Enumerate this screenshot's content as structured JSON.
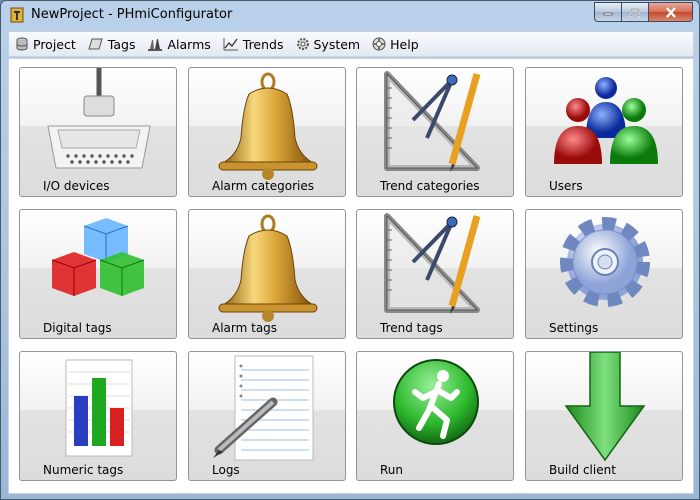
{
  "window": {
    "title": "NewProject - PHmiConfigurator"
  },
  "menu": [
    {
      "label": "Project",
      "icon": "database-icon"
    },
    {
      "label": "Tags",
      "icon": "tag-icon"
    },
    {
      "label": "Alarms",
      "icon": "alarms-icon"
    },
    {
      "label": "Trends",
      "icon": "trend-icon"
    },
    {
      "label": "System",
      "icon": "gear-icon"
    },
    {
      "label": "Help",
      "icon": "lifebuoy-icon"
    }
  ],
  "tiles": [
    {
      "label": "I/O devices",
      "icon": "connector-icon"
    },
    {
      "label": "Alarm categories",
      "icon": "bell-icon"
    },
    {
      "label": "Trend categories",
      "icon": "drafting-tools-icon"
    },
    {
      "label": "Users",
      "icon": "users-icon"
    },
    {
      "label": "Digital tags",
      "icon": "cubes-icon"
    },
    {
      "label": "Alarm tags",
      "icon": "bell-icon"
    },
    {
      "label": "Trend tags",
      "icon": "drafting-tools-icon"
    },
    {
      "label": "Settings",
      "icon": "settings-gear-icon"
    },
    {
      "label": "Numeric tags",
      "icon": "bar-chart-icon"
    },
    {
      "label": "Logs",
      "icon": "notepad-pen-icon"
    },
    {
      "label": "Run",
      "icon": "runner-icon"
    },
    {
      "label": "Build client",
      "icon": "down-arrow-icon"
    }
  ],
  "colors": {
    "close_button": "#c44a2e",
    "run_green": "#2db82d",
    "arrow_green": "#3fbf3f"
  }
}
